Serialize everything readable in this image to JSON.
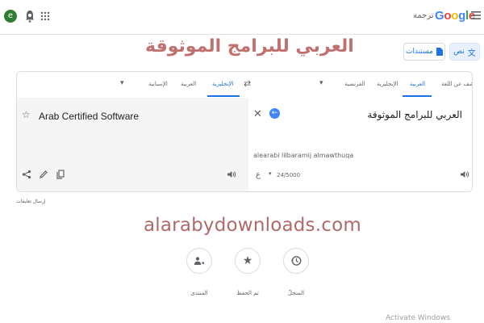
{
  "header": {
    "avatar_letter": "e",
    "logo_text": "Google",
    "app_label": "ترجمة",
    "logo_colors": [
      "#4285f4",
      "#ea4335",
      "#fbbc05",
      "#4285f4",
      "#34a853",
      "#ea4335"
    ]
  },
  "modes": {
    "text_label": "نص",
    "docs_label": "مستندات"
  },
  "headline": "العربي للبرامج الموثوقة",
  "source_langs": {
    "detect": "اكتشف عن اللغة",
    "arabic": "العربية",
    "english": "الإنجليزية",
    "french": "الفرنسية"
  },
  "target_langs": {
    "english": "الإنجليزية",
    "arabic": "العربية",
    "spanish": "الإسبانية"
  },
  "input": {
    "text": "العربي للبرامج الموثوقة",
    "transliteration": "alearabi lilbaramij almawthuqa",
    "keyboard_lang": "ع",
    "char_count": "24/5000"
  },
  "output": {
    "text": "Arab Certified Software"
  },
  "feedback_label": "إرسال تعليقات",
  "site_watermark": "alarabydownloads.com",
  "shortcuts": {
    "history": "السجلّ",
    "saved": "تم الحفظ",
    "community": "المنتدى"
  },
  "os_watermark": "Activate Windows",
  "colors": {
    "accent": "#1a73e8",
    "headline": "#c0706e"
  }
}
